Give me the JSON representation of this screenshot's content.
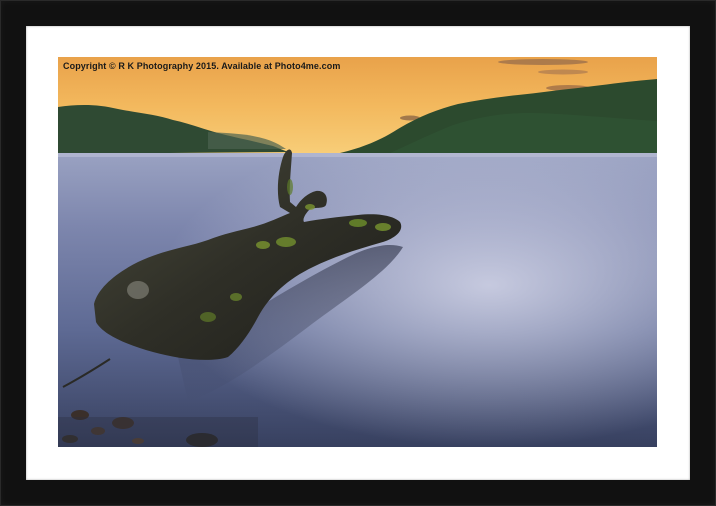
{
  "photo": {
    "watermark": "Copyright © R K Photography 2015. Available at Photo4me.com",
    "subject": "Loch shoreline at sunset with a mossy driftwood log in still water"
  },
  "colors": {
    "frame": "#111111",
    "mount": "#ffffff",
    "sky_top": "#f2b560",
    "sky_horizon": "#f7c46a",
    "water_light": "#c9cde0",
    "water_dark": "#3e4c72",
    "hills": "#2e4a30"
  }
}
